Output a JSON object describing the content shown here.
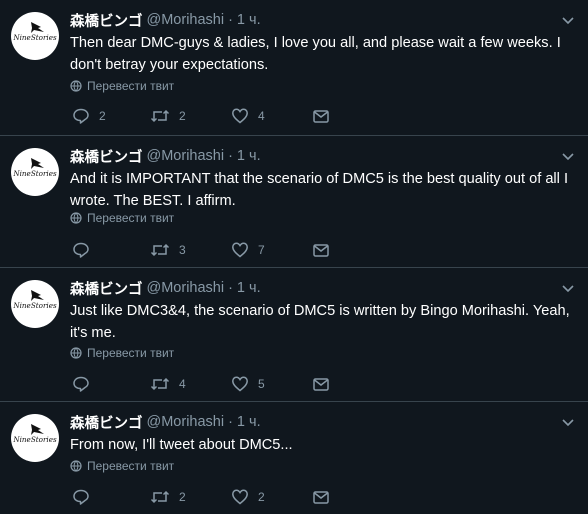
{
  "translate_label": "Перевести твит",
  "tweets": [
    {
      "name": "森橋ビンゴ",
      "handle": "@Morihashi",
      "dot": "·",
      "time": "1 ч.",
      "text": "Then dear DMC-guys & ladies, I love you all, and please wait a few weeks. I don't betray your expectations.",
      "replies": "2",
      "retweets": "2",
      "likes": "4"
    },
    {
      "name": "森橋ビンゴ",
      "handle": "@Morihashi",
      "dot": "·",
      "time": "1 ч.",
      "text": "And it is IMPORTANT that the scenario of DMC5 is the best quality out of all I wrote. The BEST. I affirm.",
      "replies": "",
      "retweets": "3",
      "likes": "7"
    },
    {
      "name": "森橋ビンゴ",
      "handle": "@Morihashi",
      "dot": "·",
      "time": "1 ч.",
      "text": "Just like DMC3&4, the scenario of DMC5 is written by Bingo Morihashi. Yeah, it's me.",
      "replies": "",
      "retweets": "4",
      "likes": "5"
    },
    {
      "name": "森橋ビンゴ",
      "handle": "@Morihashi",
      "dot": "·",
      "time": "1 ч.",
      "text": "From now, I'll tweet about DMC5...",
      "replies": "",
      "retweets": "2",
      "likes": "2"
    }
  ],
  "avatar_text": "NineStories",
  "icons": {
    "reply": "reply-icon",
    "retweet": "retweet-icon",
    "like": "heart-icon",
    "dm": "envelope-icon",
    "translate": "globe-icon",
    "menu": "chevron-down-icon"
  },
  "colors": {
    "background": "#10171e",
    "text": "#ffffff",
    "secondary": "#8899a6",
    "divider": "#38444d"
  }
}
